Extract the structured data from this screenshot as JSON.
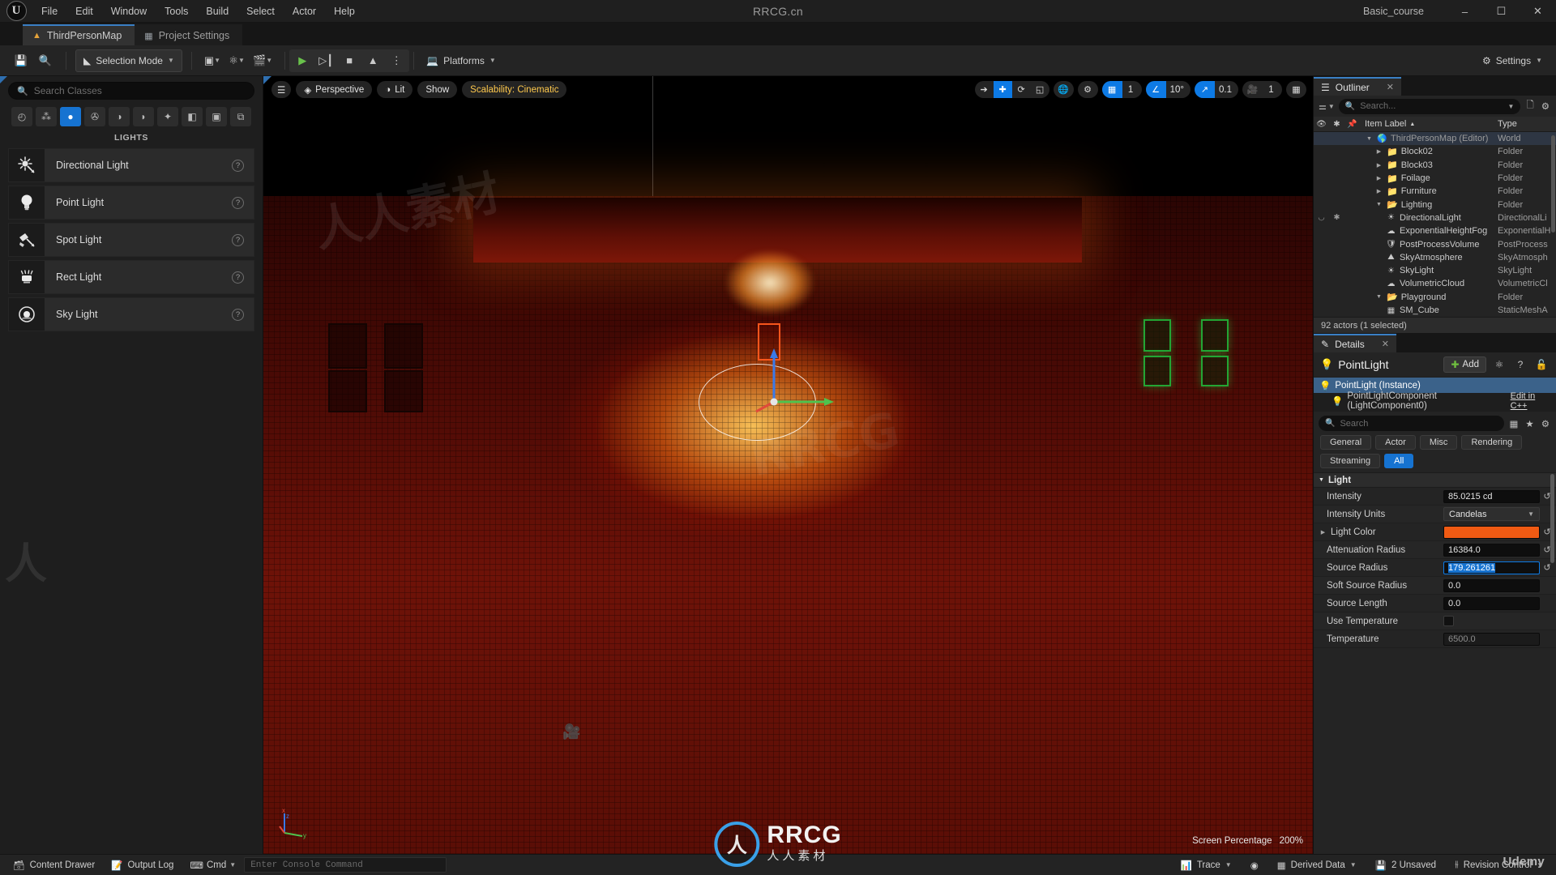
{
  "menu": {
    "items": [
      "File",
      "Edit",
      "Window",
      "Tools",
      "Build",
      "Select",
      "Actor",
      "Help"
    ],
    "center_title": "RRCG.cn",
    "project_name": "Basic_course",
    "window_buttons": {
      "minimize": "–",
      "maximize": "☐",
      "close": "✕"
    }
  },
  "tabs": [
    {
      "label": "ThirdPersonMap",
      "icon": "level-icon",
      "active": true
    },
    {
      "label": "Project Settings",
      "icon": "cube-icon",
      "active": false
    }
  ],
  "toolbar": {
    "save_icon": "save-icon",
    "browse_icon": "browse-content-icon",
    "mode_label": "Selection Mode",
    "add_icon": "add-actor-icon",
    "blueprint_icon": "blueprints-icon",
    "cinematics_icon": "cinematics-icon",
    "play_icon": "▶",
    "skip_icon": "⏵❘",
    "stop_icon": "■",
    "eject_icon": "▲",
    "more_icon": "⋮",
    "platforms_label": "Platforms",
    "settings_label": "Settings"
  },
  "place_actors": {
    "search_placeholder": "Search Classes",
    "categories": [
      {
        "name": "recently-placed-icon",
        "glyph": "◴",
        "active": false
      },
      {
        "name": "basic-icon",
        "glyph": "⁂",
        "active": false
      },
      {
        "name": "lights-icon",
        "glyph": "●",
        "active": true
      },
      {
        "name": "cinematic-icon",
        "glyph": "✇",
        "active": false
      },
      {
        "name": "visual-effects-icon",
        "glyph": "◑",
        "active": false
      },
      {
        "name": "geometry-icon",
        "glyph": "◗",
        "active": false
      },
      {
        "name": "volumes-icon",
        "glyph": "✦",
        "active": false
      },
      {
        "name": "all-classes-icon",
        "glyph": "◧",
        "active": false
      },
      {
        "name": "shapes-icon",
        "glyph": "▣",
        "active": false
      },
      {
        "name": "layers-icon",
        "glyph": "⧉",
        "active": false
      }
    ],
    "category_title": "LIGHTS",
    "items": [
      {
        "label": "Directional Light",
        "icon": "directional-light-icon",
        "glyph": "☀",
        "help": "?"
      },
      {
        "label": "Point Light",
        "icon": "point-light-icon",
        "glyph": "Ὂ1",
        "help": "?"
      },
      {
        "label": "Spot Light",
        "icon": "spot-light-icon",
        "glyph": "◢",
        "help": "?"
      },
      {
        "label": "Rect Light",
        "icon": "rect-light-icon",
        "glyph": "▒",
        "help": "?"
      },
      {
        "label": "Sky Light",
        "icon": "sky-light-icon",
        "glyph": "◉",
        "help": "?"
      }
    ]
  },
  "viewport": {
    "menu_icon": "viewport-menu-icon",
    "perspective_label": "Perspective",
    "lit_label": "Lit",
    "show_label": "Show",
    "scalability_label": "Scalability: Cinematic",
    "select_icon": "select-arrow-icon",
    "move_icon": "move-gizmo-icon",
    "rotate_icon": "rotate-gizmo-icon",
    "scale_icon": "scale-gizmo-icon",
    "world_icon": "world-coordinates-icon",
    "surface_snap_icon": "surface-snap-icon",
    "grid_snap_icon": "grid-snap-icon",
    "grid_snap_value": "1",
    "angle_snap_icon": "angle-snap-icon",
    "angle_snap_value": "10°",
    "scale_snap_icon": "scale-snap-icon",
    "scale_snap_value": "0.1",
    "camera_speed_icon": "camera-speed-icon",
    "camera_speed_value": "1",
    "maximize_icon": "maximize-viewport-icon",
    "screen_percentage_label": "Screen Percentage",
    "screen_percentage_value": "200%",
    "axis_x": "x",
    "axis_y": "y",
    "axis_z": "z"
  },
  "outliner": {
    "tab_label": "Outliner",
    "close_icon": "✕",
    "search_placeholder": "Search...",
    "filter_icon": "filter-icon",
    "add_icon": "add-folder-icon",
    "settings_icon": "outliner-settings-icon",
    "columns": {
      "visibility": "eye-icon",
      "pinned": "star-icon",
      "marker": "pin-icon",
      "label": "Item Label",
      "sort": "▲",
      "type": "Type"
    },
    "rows": [
      {
        "label": "ThirdPersonMap (Editor)",
        "type": "World",
        "depth": 0,
        "kind": "world",
        "clipped": true,
        "expander": "▼"
      },
      {
        "label": "Block02",
        "type": "Folder",
        "depth": 1,
        "kind": "folder",
        "expander": "▶"
      },
      {
        "label": "Block03",
        "type": "Folder",
        "depth": 1,
        "kind": "folder",
        "expander": "▶"
      },
      {
        "label": "Foilage",
        "type": "Folder",
        "depth": 1,
        "kind": "folder",
        "expander": "▶"
      },
      {
        "label": "Furniture",
        "type": "Folder",
        "depth": 1,
        "kind": "folder",
        "expander": "▶"
      },
      {
        "label": "Lighting",
        "type": "Folder",
        "depth": 1,
        "kind": "folder-open",
        "expander": "▼"
      },
      {
        "label": "DirectionalLight",
        "type": "DirectionalLi",
        "depth": 2,
        "kind": "directional-light",
        "eye": "◡",
        "star": "★"
      },
      {
        "label": "ExponentialHeightFog",
        "type": "ExponentialH",
        "depth": 2,
        "kind": "fog"
      },
      {
        "label": "PostProcessVolume",
        "type": "PostProcess",
        "depth": 2,
        "kind": "postprocess"
      },
      {
        "label": "SkyAtmosphere",
        "type": "SkyAtmosph",
        "depth": 2,
        "kind": "sky-atmosphere"
      },
      {
        "label": "SkyLight",
        "type": "SkyLight",
        "depth": 2,
        "kind": "sky-light"
      },
      {
        "label": "VolumetricCloud",
        "type": "VolumetricCl",
        "depth": 2,
        "kind": "volumetric-cloud"
      },
      {
        "label": "Playground",
        "type": "Folder",
        "depth": 1,
        "kind": "folder-open",
        "expander": "▼"
      },
      {
        "label": "SM_Cube",
        "type": "StaticMeshA",
        "depth": 2,
        "kind": "static-mesh"
      }
    ],
    "status": "92 actors (1 selected)"
  },
  "details": {
    "tab_label": "Details",
    "close_icon": "✕",
    "title": "PointLight",
    "title_icon": "point-light-icon",
    "add_label": "Add",
    "blueprint_icon": "blueprint-icon",
    "help_icon": "?",
    "lock_icon": "unlock-icon",
    "components": [
      {
        "label": "PointLight (Instance)",
        "selected": true,
        "link": ""
      },
      {
        "label": "PointLightComponent (LightComponent0)",
        "selected": false,
        "link": "Edit in C++"
      }
    ],
    "search_placeholder": "Search",
    "column_icon": "column-settings-icon",
    "favorite_icon": "favorite-icon",
    "settings_icon": "details-settings-icon",
    "filters": [
      {
        "label": "General",
        "active": false
      },
      {
        "label": "Actor",
        "active": false
      },
      {
        "label": "Misc",
        "active": false
      },
      {
        "label": "Rendering",
        "active": false
      },
      {
        "label": "Streaming",
        "active": false
      },
      {
        "label": "All",
        "active": true
      }
    ],
    "section": "Light",
    "properties": [
      {
        "name": "Intensity",
        "value": "85.0215 cd",
        "type": "text",
        "reset": true
      },
      {
        "name": "Intensity Units",
        "value": "Candelas",
        "type": "combo",
        "reset": false
      },
      {
        "name": "Light Color",
        "value": "#F05A13",
        "type": "color",
        "reset": true,
        "expandable": true
      },
      {
        "name": "Attenuation Radius",
        "value": "16384.0",
        "type": "text",
        "reset": true
      },
      {
        "name": "Source Radius",
        "value": "179.261261",
        "type": "text",
        "reset": true,
        "focused": true
      },
      {
        "name": "Soft Source Radius",
        "value": "0.0",
        "type": "text",
        "reset": false
      },
      {
        "name": "Source Length",
        "value": "0.0",
        "type": "text",
        "reset": false
      },
      {
        "name": "Use Temperature",
        "value": "",
        "type": "checkbox",
        "reset": false
      },
      {
        "name": "Temperature",
        "value": "6500.0",
        "type": "text-dim",
        "reset": false
      }
    ]
  },
  "statusbar": {
    "content_drawer": "Content Drawer",
    "output_log": "Output Log",
    "cmd_label": "Cmd",
    "console_placeholder": "Enter Console Command",
    "trace": "Trace",
    "derived_data": "Derived Data",
    "unsaved": "2 Unsaved",
    "revision_control": "Revision Control"
  },
  "watermarks": {
    "brand_big": "RRCG",
    "brand_small": "人人素材",
    "brand_mark": "人",
    "udemy": "Udemy"
  },
  "colors": {
    "accent_blue": "#0d7ae5",
    "light_color": "#F05A13",
    "scalability_yellow": "#ffc94d",
    "folder_yellow": "#d8a553"
  }
}
